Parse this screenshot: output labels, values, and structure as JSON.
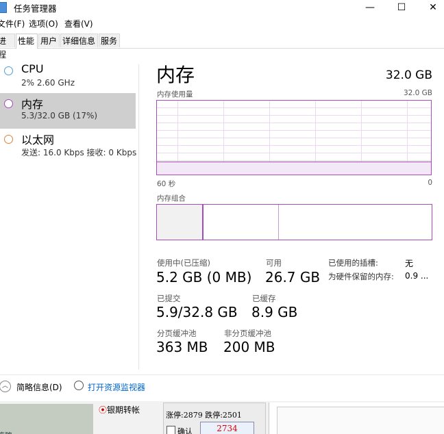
{
  "window": {
    "title": "任务管理器",
    "minimize_glyph": "—",
    "maximize_glyph": "☐",
    "close_glyph": "✕"
  },
  "menu": [
    "文件(F)",
    "选项(O)",
    "查看(V)"
  ],
  "tabs": [
    "进程",
    "性能",
    "用户",
    "详细信息",
    "服务"
  ],
  "sidebar": {
    "items": [
      {
        "title": "CPU",
        "sub": "2%  2.60 GHz",
        "circle_color": "#4a9edb"
      },
      {
        "title": "内存",
        "sub": "5.3/32.0 GB (17%)",
        "circle_color": "#a44cb8"
      },
      {
        "title": "以太网",
        "sub": "发送: 16.0 Kbps 接收: 0 Kbps",
        "circle_color": "#d9843b"
      }
    ]
  },
  "main": {
    "title": "内存",
    "total": "32.0 GB",
    "graph": {
      "label": "内存使用量",
      "max_label": "32.0 GB",
      "time_label": "60 秒",
      "min_label": "0",
      "usage_fraction": 0.17
    },
    "composition_label": "内存组合",
    "stats": {
      "in_use_label": "使用中(已压缩)",
      "in_use_value": "5.2 GB (0 MB)",
      "available_label": "可用",
      "available_value": "26.7 GB",
      "committed_label": "已提交",
      "committed_value": "5.9/32.8 GB",
      "cached_label": "已缓存",
      "cached_value": "8.9 GB",
      "paged_label": "分页缓冲池",
      "paged_value": "363 MB",
      "nonpaged_label": "非分页缓冲池",
      "nonpaged_value": "200 MB",
      "slots_label": "已使用的插槽:",
      "slots_value": "无",
      "reserved_label": "为硬件保留的内存:",
      "reserved_value": "0.9 ..."
    }
  },
  "footer": {
    "brief_label": "简略信息(D)",
    "monitor_label": "打开资源监视器"
  },
  "background_window": {
    "left_text": "策略",
    "radio_label": "银期转帐",
    "stats_text": "涨停:2879 跌停:2501",
    "confirm_label": "确认",
    "price": "2734"
  },
  "colors": {
    "memory_accent": "#a44cb8",
    "link": "#0066cc"
  }
}
